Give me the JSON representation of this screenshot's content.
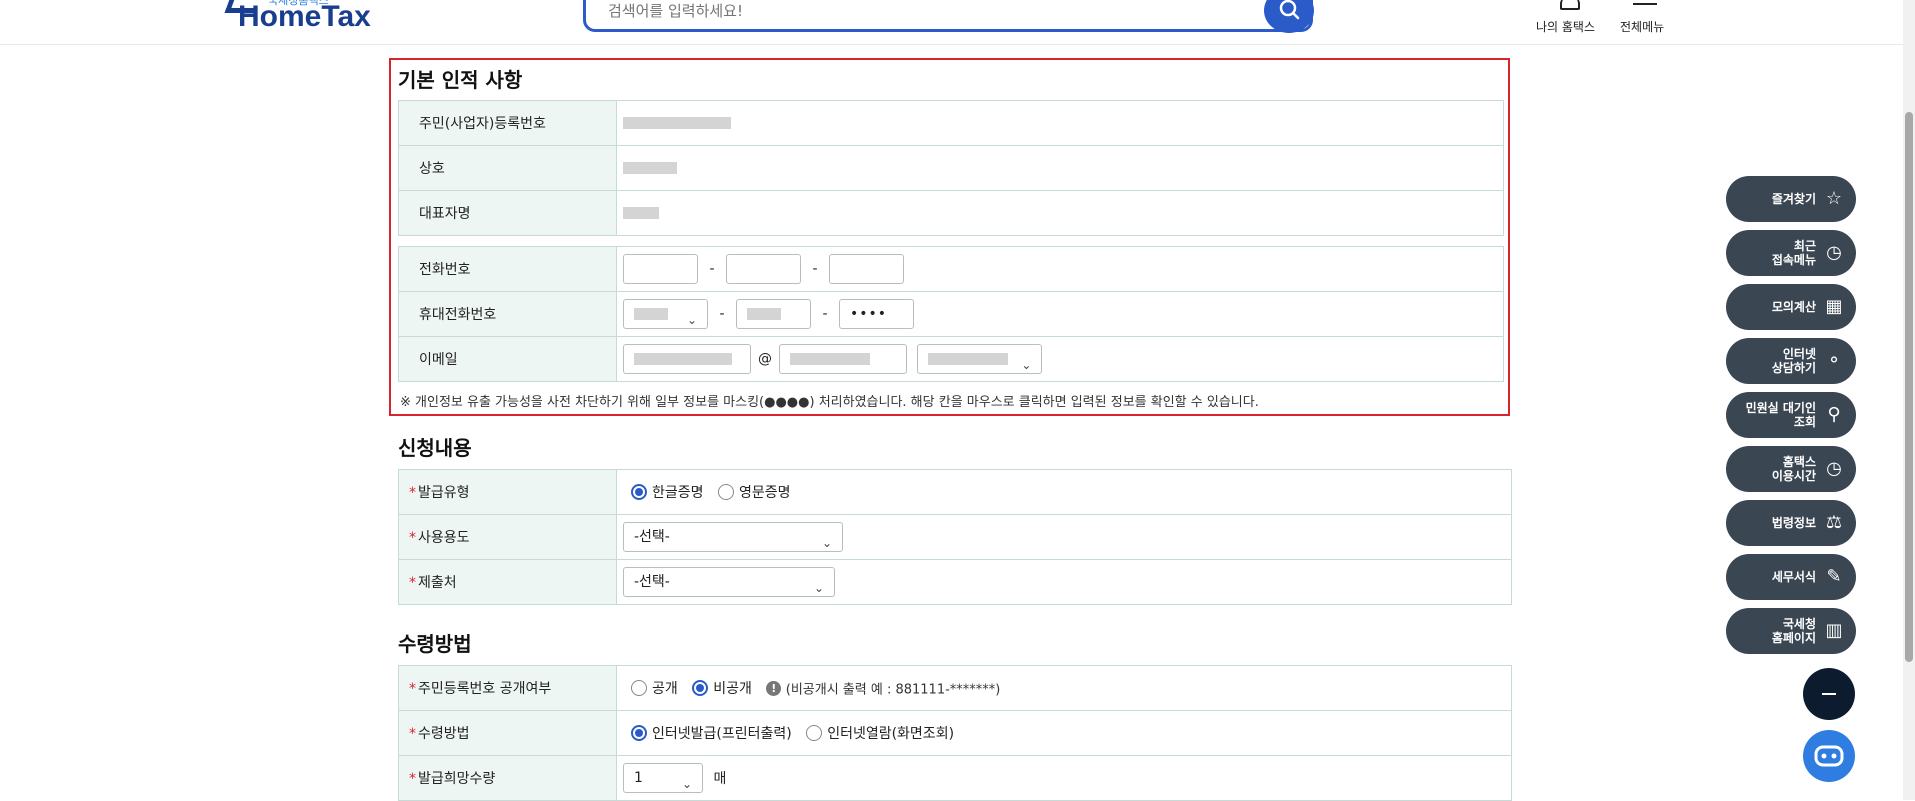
{
  "header": {
    "logo_small": "국세청홈택스",
    "logo_big": "HomeTax",
    "search_placeholder": "검색어를 입력하세요!",
    "my_hometax": "나의 홈택스",
    "all_menu": "전체메뉴"
  },
  "basic": {
    "title": "기본 인적 사항",
    "rows": [
      "주민(사업자)등록번호",
      "상호",
      "대표자명"
    ],
    "contact_rows": [
      "전화번호",
      "휴대전화번호",
      "이메일"
    ],
    "dash": "-",
    "at": "@",
    "mobile_last": "••••",
    "notice": "※ 개인정보 유출 가능성을 사전 차단하기 위해 일부 정보를 마스킹(●●●●) 처리하였습니다. 해당 칸을 마우스로 클릭하면 입력된 정보를 확인할 수 있습니다."
  },
  "application": {
    "title": "신청내용",
    "type_label": "발급유형",
    "type_options": [
      "한글증명",
      "영문증명"
    ],
    "type_selected": "한글증명",
    "usage_label": "사용용도",
    "usage_value": "-선택-",
    "submit_label": "제출처",
    "submit_value": "-선택-"
  },
  "receive": {
    "title": "수령방법",
    "rrn_label": "주민등록번호 공개여부",
    "rrn_options": [
      "공개",
      "비공개"
    ],
    "rrn_selected": "비공개",
    "rrn_hint": "(비공개시 출력 예 : 881111-*******)",
    "method_label": "수령방법",
    "method_options": [
      "인터넷발급(프린터출력)",
      "인터넷열람(화면조회)"
    ],
    "method_selected": "인터넷발급(프린터출력)",
    "qty_label": "발급희망수량",
    "qty_value": "1",
    "qty_unit": "매"
  },
  "side_menu": [
    {
      "label": "즐겨찾기",
      "icon": "star-icon"
    },
    {
      "label": "최근\n접속메뉴",
      "icon": "clock-icon"
    },
    {
      "label": "모의계산",
      "icon": "calculator-icon"
    },
    {
      "label": "인터넷\n상담하기",
      "icon": "headset-icon"
    },
    {
      "label": "민원실 대기인\n조회",
      "icon": "search-person-icon"
    },
    {
      "label": "홈택스\n이용시간",
      "icon": "alarm-clock-icon"
    },
    {
      "label": "법령정보",
      "icon": "gavel-icon"
    },
    {
      "label": "세무서식",
      "icon": "document-edit-icon"
    },
    {
      "label": "국세청\n홈페이지",
      "icon": "building-icon"
    }
  ],
  "colors": {
    "accent": "#2a5bc9",
    "highlight_border": "#d8252c",
    "fab_bg": "#3b4653",
    "label_bg": "#eef6f3"
  }
}
